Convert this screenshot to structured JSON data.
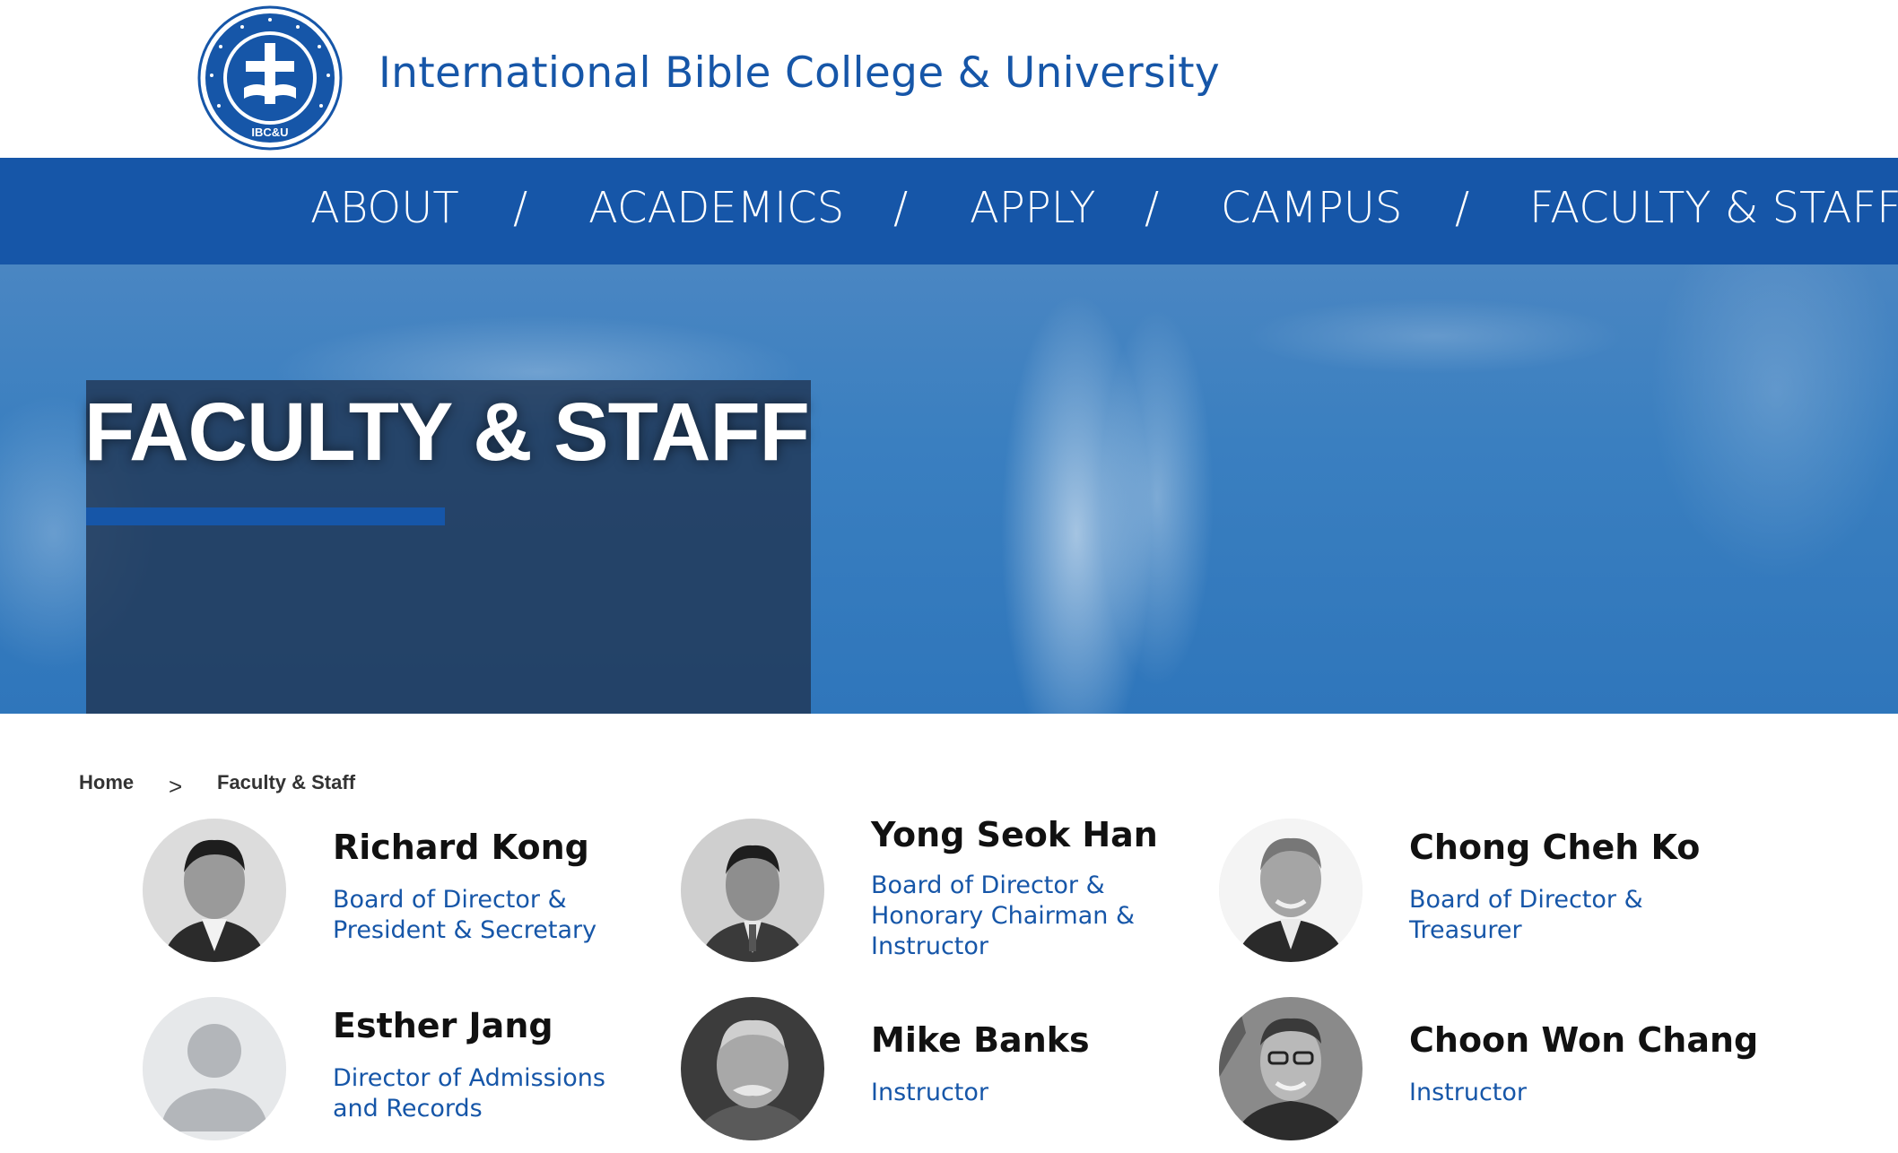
{
  "site": {
    "title": "International Bible College & University",
    "logo_text": "International Bible College & University",
    "logo_abbr": "IBC&U"
  },
  "nav": {
    "items": [
      "ABOUT",
      "ACADEMICS",
      "APPLY",
      "CAMPUS",
      "FACULTY & STAFF"
    ],
    "separator": "/"
  },
  "hero": {
    "title": "FACULTY & STAFF"
  },
  "breadcrumb": {
    "home": "Home",
    "separator": ">",
    "current": "Faculty & Staff"
  },
  "staff": [
    {
      "name": "Richard Kong",
      "role": "Board of Director & President & Secretary",
      "photo": "portrait-photo"
    },
    {
      "name": "Yong Seok Han",
      "role": "Board of Director & Honorary Chairman & Instructor",
      "photo": "portrait-photo"
    },
    {
      "name": "Chong Cheh Ko",
      "role": "Board of Director & Treasurer",
      "photo": "portrait-photo"
    },
    {
      "name": "Esther Jang",
      "role": "Director of Admissions and Records",
      "photo": "placeholder-avatar"
    },
    {
      "name": "Mike Banks",
      "role": "Instructor",
      "photo": "portrait-photo"
    },
    {
      "name": "Choon Won Chang",
      "role": "Instructor",
      "photo": "portrait-photo"
    }
  ],
  "colors": {
    "brand": "#1656a8",
    "hero_box": "#213755",
    "text_dark": "#111111"
  }
}
